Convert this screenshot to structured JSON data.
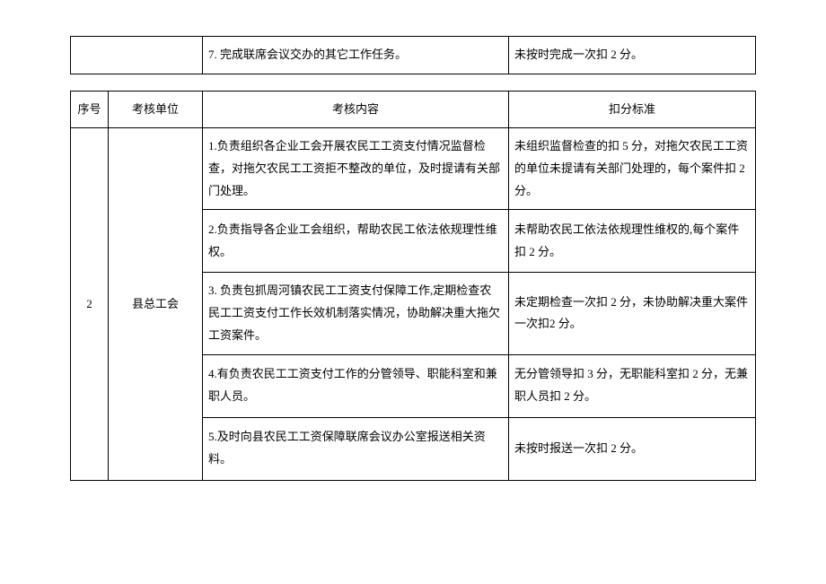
{
  "top_fragment": {
    "content": "7. 完成联席会议交办的其它工作任务。",
    "standard": "未按时完成一次扣 2 分。"
  },
  "headers": {
    "index": "序号",
    "unit": "考核单位",
    "content": "考核内容",
    "standard": "扣分标准"
  },
  "row": {
    "index": "2",
    "unit": "县总工会",
    "items": [
      {
        "content": "1.负责组织各企业工会开展农民工工资支付情况监督检查，对拖欠农民工工资拒不整改的单位，及时提请有关部门处理。",
        "standard": "未组织监督检查的扣 5 分，对拖欠农民工工资的单位未提请有关部门处理的，每个案件扣 2 分。"
      },
      {
        "content": "2.负责指导各企业工会组织，帮助农民工依法依规理性维权。",
        "standard": "未帮助农民工依法依规理性维权的,每个案件扣 2 分。"
      },
      {
        "content": "3. 负责包抓周河镇农民工工资支付保障工作,定期检查农民工工资支付工作长效机制落实情况，协助解决重大拖欠工资案件。",
        "standard": "未定期检查一次扣 2 分，未协助解决重大案件一次扣2 分。"
      },
      {
        "content": "4.有负责农民工工资支付工作的分管领导、职能科室和兼职人员。",
        "standard": "无分管领导扣 3 分，无职能科室扣 2 分，无兼职人员扣 2 分。"
      },
      {
        "content": "5.及时向县农民工工资保障联席会议办公室报送相关资料。",
        "standard": "未按时报送一次扣 2 分。"
      }
    ]
  }
}
